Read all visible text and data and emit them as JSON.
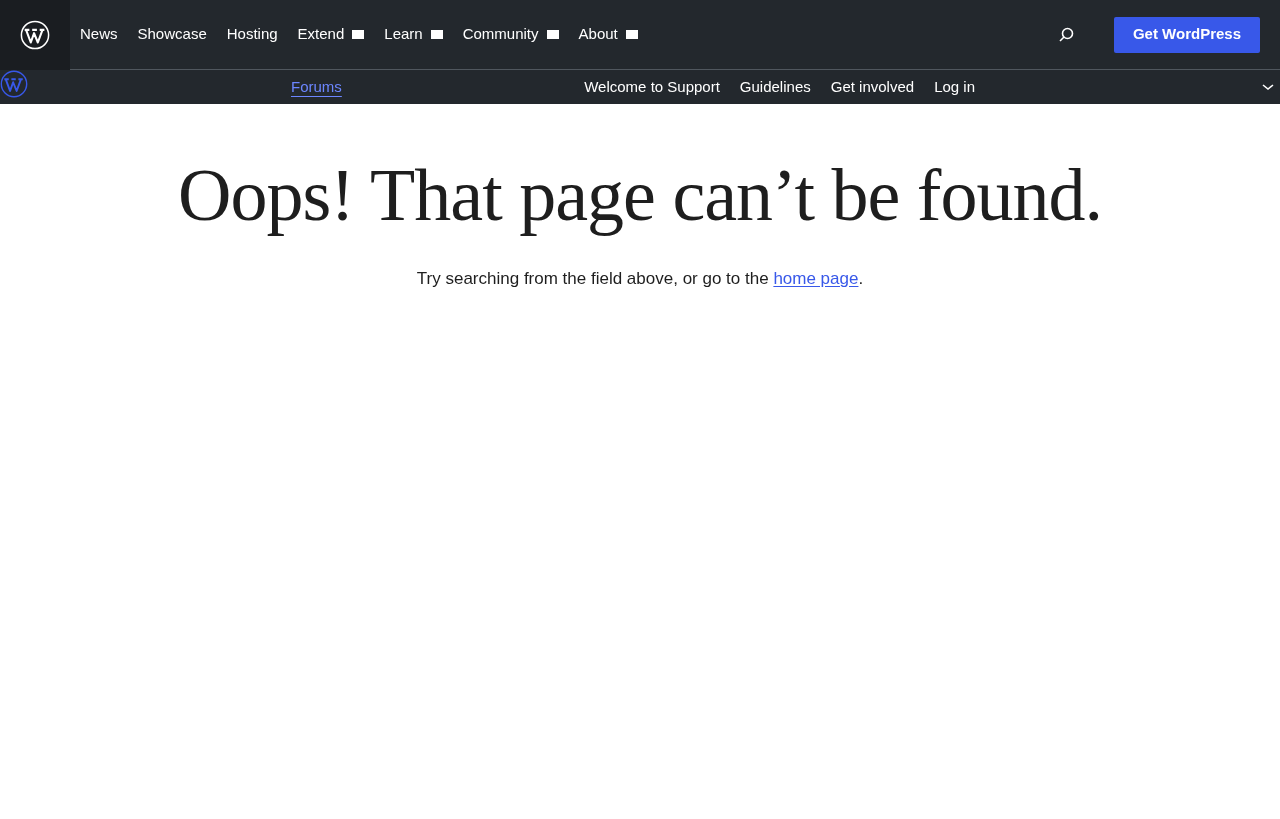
{
  "header": {
    "nav": [
      {
        "label": "News",
        "kind": "link"
      },
      {
        "label": "Showcase",
        "kind": "link"
      },
      {
        "label": "Hosting",
        "kind": "link"
      },
      {
        "label": "Extend",
        "kind": "menu"
      },
      {
        "label": "Learn",
        "kind": "menu"
      },
      {
        "label": "Community",
        "kind": "menu"
      },
      {
        "label": "About",
        "kind": "menu"
      }
    ],
    "cta": "Get WordPress"
  },
  "subnav": {
    "section": {
      "label": "Forums",
      "selected": true
    },
    "items": [
      {
        "label": "Welcome to Support",
        "selected": false
      },
      {
        "label": "Guidelines",
        "selected": false
      },
      {
        "label": "Get involved",
        "selected": false
      },
      {
        "label": "Log in",
        "selected": false
      }
    ]
  },
  "main": {
    "title": "Oops! That page can’t be found.",
    "message": {
      "before": "Try searching from the field above, or go to the ",
      "link": "home page",
      "after": "."
    }
  }
}
